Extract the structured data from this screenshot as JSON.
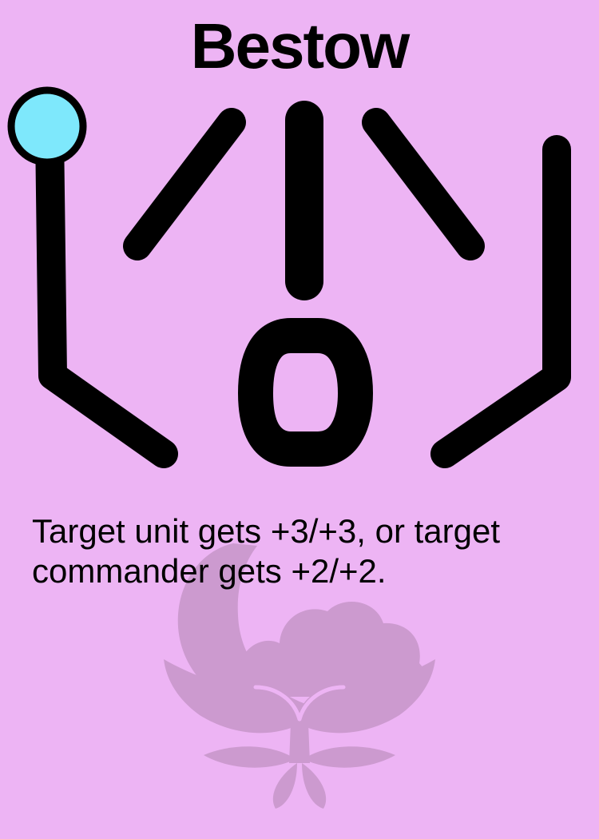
{
  "card": {
    "title": "Bestow",
    "rules_text": "Target unit gets +3/+3, or target commander gets +2/+2.",
    "background_color": "#edb4f4",
    "stroke_color": "#000000",
    "node_color": "#7ee8fc",
    "watermark_color": "#cc9acf",
    "watermark_icon": "moon-flower-watermark-icon",
    "glyph_icon": "spell-glyph-icon"
  }
}
